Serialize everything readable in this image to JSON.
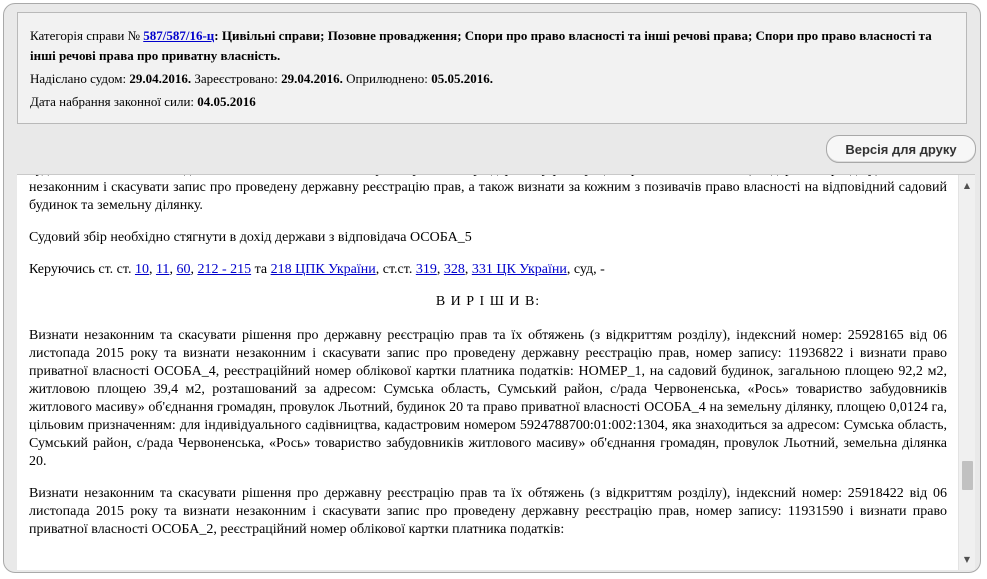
{
  "info": {
    "category_label": "Категорія справи №",
    "case_number": "587/587/16-ц",
    "category_value": ": Цивільні справи; Позовне провадження; Спори про право власності та інші речові права; Спори про право власності та інші речові права про приватну власність.",
    "sent_label": "Надіслано судом:",
    "sent_date": "29.04.2016.",
    "registered_label": "Зареєстровано:",
    "registered_date": "29.04.2016.",
    "published_label": "Оприлюднено:",
    "published_date": "05.05.2016.",
    "effective_label": "Дата набрання законної сили:",
    "effective_date": "04.05.2016"
  },
  "toolbar": {
    "print_label": "Версія для друку"
  },
  "document": {
    "p1": "будинок, вважає за необхідне визнати незаконним та скасувати рішення про державну реєстрацію прав та їх обтяжень (з відкриттям розділу) та визнати незаконним і скасувати запис про проведену державну реєстрацію прав, а також визнати за кожним з позивачів право власності на відповідний садовий будинок та земельну ділянку.",
    "p2": "Судовий збір необхідно стягнути в дохід держави з відповідача ОСОБА_5",
    "p3": {
      "prefix": "Керуючись ст. ст. ",
      "link1": "10",
      "sep1": ", ",
      "link2": "11",
      "sep2": ", ",
      "link3": "60",
      "sep3": ", ",
      "link4": "212 - 215",
      "mid": " та ",
      "link5": "218 ЦПК України",
      "mid2": ", ст.ст. ",
      "link6": "319",
      "sep4": ", ",
      "link7": "328",
      "sep5": ", ",
      "link8": "331 ЦК України",
      "suffix": ", суд, -"
    },
    "heading": "В И Р І Ш И В:",
    "p4": "Визнати незаконним та скасувати рішення про державну реєстрацію прав та їх обтяжень (з відкриттям розділу), індексний номер: 25928165 від 06 листопада 2015 року та визнати незаконним і скасувати запис про проведену державну реєстрацію прав, номер запису: 11936822 і визнати право приватної власності ОСОБА_4, реєстраційний номер облікової картки платника податків: НОМЕР_1, на садовий будинок, загальною площею 92,2 м2, житловою площею 39,4 м2, розташований за адресом: Сумська область, Сумський район, с/рада Червоненська, «Рось» товариство забудовників житлового масиву» об'єднання громадян, провулок Льотний, будинок 20 та право приватної власності ОСОБА_4 на земельну ділянку, площею 0,0124 га, цільовим призначенням: для індивідуального садівництва, кадастровим номером 5924788700:01:002:1304, яка знаходиться за адресом: Сумська область, Сумський район, с/рада Червоненська, «Рось» товариство забудовників житлового масиву» об'єднання громадян, провулок Льотний, земельна ділянка 20.",
    "p5": "Визнати незаконним та скасувати рішення про державну реєстрацію прав та їх обтяжень (з відкриттям розділу), індексний номер: 25918422 від 06 листопада 2015 року та визнати незаконним і скасувати запис про проведену державну реєстрацію прав, номер запису: 11931590 і визнати право приватної власності ОСОБА_2, реєстраційний номер облікової картки платника податків:"
  },
  "icons": {
    "scroll_up": "scroll-up-arrow-icon",
    "scroll_down": "scroll-down-arrow-icon"
  },
  "colors": {
    "link": "#0000cc",
    "frame_bg": "#e9e9e9"
  }
}
